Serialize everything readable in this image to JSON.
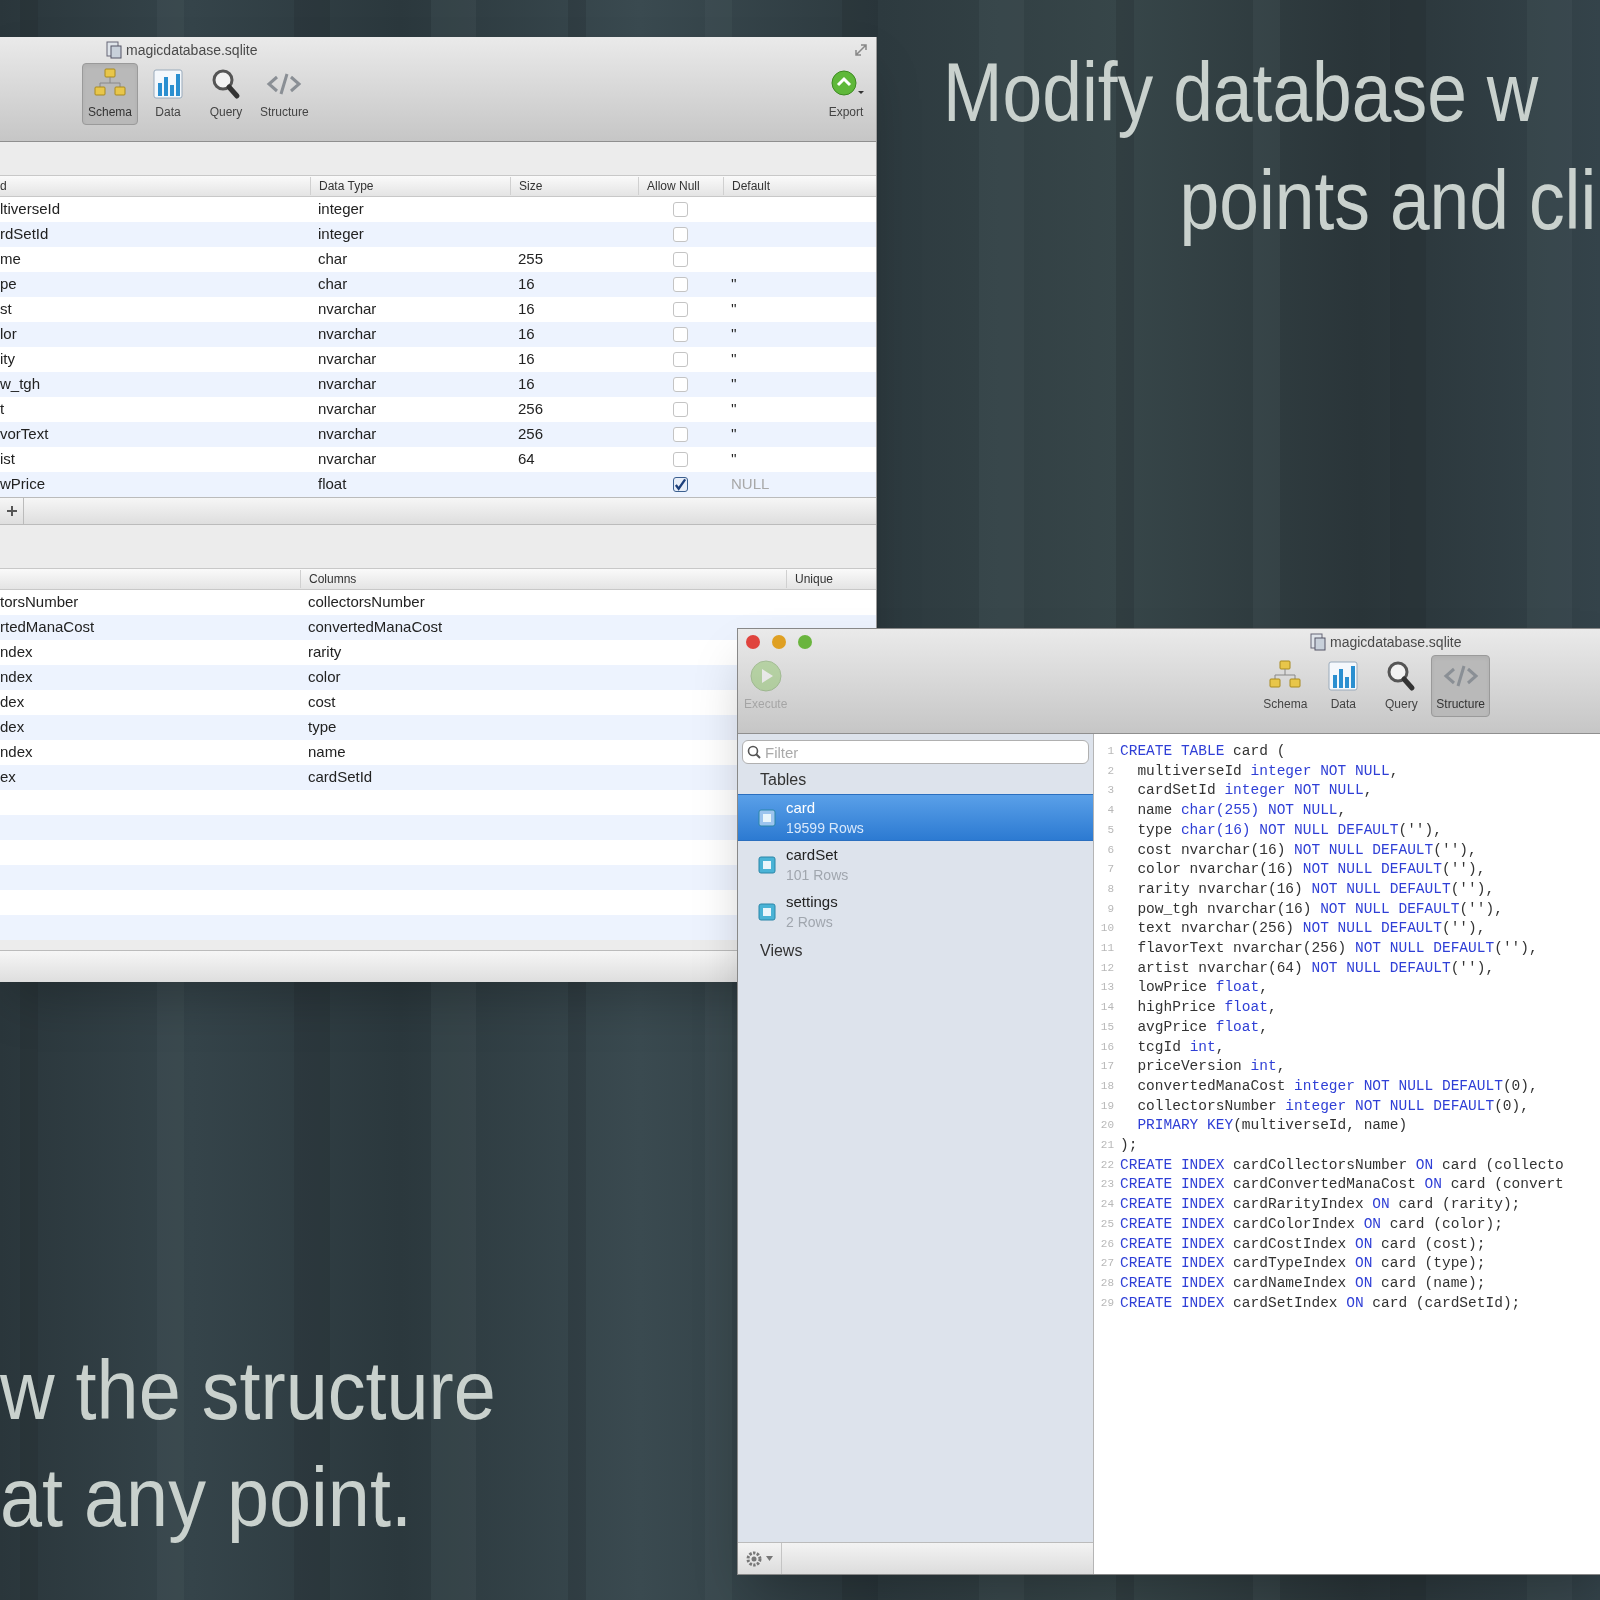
{
  "headline": [
    "Modify database w",
    "points and cli"
  ],
  "caption": [
    "w the structure",
    "at any point."
  ],
  "schema_window": {
    "title": "magicdatabase.sqlite",
    "toolbar": [
      {
        "label": "Schema",
        "kind": "schema",
        "selected": true
      },
      {
        "label": "Data",
        "kind": "data",
        "selected": false
      },
      {
        "label": "Query",
        "kind": "query",
        "selected": false
      },
      {
        "label": "Structure",
        "kind": "structure",
        "selected": false
      }
    ],
    "export": {
      "label": "Export"
    },
    "fields_table": {
      "columns": [
        "d",
        "Data Type",
        "Size",
        "Allow Null",
        "Default"
      ],
      "rows": [
        {
          "name": "ltiverseId",
          "data_type": "integer",
          "allow_null": false
        },
        {
          "name": "rdSetId",
          "data_type": "integer",
          "allow_null": false
        },
        {
          "name": "me",
          "data_type": "char",
          "size": "255",
          "allow_null": false
        },
        {
          "name": "pe",
          "data_type": "char",
          "size": "16",
          "allow_null": false,
          "default": "''",
          "dimmed": false
        },
        {
          "name": "st",
          "data_type": "nvarchar",
          "size": "16",
          "allow_null": false,
          "default": "''",
          "dimmed": false
        },
        {
          "name": "lor",
          "data_type": "nvarchar",
          "size": "16",
          "allow_null": false,
          "default": "''",
          "dimmed": false
        },
        {
          "name": "ity",
          "data_type": "nvarchar",
          "size": "16",
          "allow_null": false,
          "default": "''",
          "dimmed": false
        },
        {
          "name": "w_tgh",
          "data_type": "nvarchar",
          "size": "16",
          "allow_null": false,
          "default": "''",
          "dimmed": false
        },
        {
          "name": "t",
          "data_type": "nvarchar",
          "size": "256",
          "allow_null": false,
          "default": "''",
          "dimmed": false
        },
        {
          "name": "vorText",
          "data_type": "nvarchar",
          "size": "256",
          "allow_null": false,
          "default": "''",
          "dimmed": false
        },
        {
          "name": "ist",
          "data_type": "nvarchar",
          "size": "64",
          "allow_null": false,
          "default": "''",
          "dimmed": false
        },
        {
          "name": "wPrice",
          "data_type": "float",
          "allow_null": true,
          "default": "NULL",
          "dimmed": true
        }
      ]
    },
    "indexes_table": {
      "columns": [
        "Columns",
        "Unique"
      ],
      "rows": [
        {
          "name": "torsNumber",
          "columns": "collectorsNumber"
        },
        {
          "name": "rtedManaCost",
          "columns": "convertedManaCost"
        },
        {
          "name": "ndex",
          "columns": "rarity"
        },
        {
          "name": "ndex",
          "columns": "color"
        },
        {
          "name": "dex",
          "columns": "cost"
        },
        {
          "name": "dex",
          "columns": "type"
        },
        {
          "name": "ndex",
          "columns": "name"
        },
        {
          "name": "ex",
          "columns": "cardSetId"
        }
      ]
    }
  },
  "sql_window": {
    "title": "magicdatabase.sqlite",
    "execute": {
      "label": "Execute",
      "disabled": true
    },
    "toolbar": [
      {
        "label": "Schema",
        "kind": "schema",
        "selected": false
      },
      {
        "label": "Data",
        "kind": "data",
        "selected": false
      },
      {
        "label": "Query",
        "kind": "query",
        "selected": false
      },
      {
        "label": "Structure",
        "kind": "structure",
        "selected": true
      }
    ],
    "filter": {
      "placeholder": "Filter"
    },
    "sidebar": {
      "sections": [
        {
          "label": "Tables",
          "items": [
            {
              "name": "card",
              "rows": "19599 Rows",
              "selected": true
            },
            {
              "name": "cardSet",
              "rows": "101 Rows",
              "selected": false
            },
            {
              "name": "settings",
              "rows": "2 Rows",
              "selected": false
            }
          ]
        },
        {
          "label": "Views"
        }
      ]
    },
    "code": [
      {
        "number": "1",
        "segments": [
          {
            "text": "CREATE TABLE",
            "kind": "keyword"
          },
          {
            "text": " card (",
            "kind": "plain"
          }
        ]
      },
      {
        "number": "2",
        "segments": [
          {
            "text": "  multiverseId ",
            "kind": "plain"
          },
          {
            "text": "integer NOT NULL",
            "kind": "keyword"
          },
          {
            "text": ",",
            "kind": "plain"
          }
        ]
      },
      {
        "number": "3",
        "segments": [
          {
            "text": "  cardSetId ",
            "kind": "plain"
          },
          {
            "text": "integer NOT NULL",
            "kind": "keyword"
          },
          {
            "text": ",",
            "kind": "plain"
          }
        ]
      },
      {
        "number": "4",
        "segments": [
          {
            "text": "  name ",
            "kind": "plain"
          },
          {
            "text": "char(255) NOT NULL",
            "kind": "keyword"
          },
          {
            "text": ",",
            "kind": "plain"
          }
        ]
      },
      {
        "number": "5",
        "segments": [
          {
            "text": "  type ",
            "kind": "plain"
          },
          {
            "text": "char(16) NOT NULL DEFAULT",
            "kind": "keyword"
          },
          {
            "text": "(''),",
            "kind": "plain"
          }
        ]
      },
      {
        "number": "6",
        "segments": [
          {
            "text": "  cost nvarchar(16) ",
            "kind": "plain"
          },
          {
            "text": "NOT NULL DEFAULT",
            "kind": "keyword"
          },
          {
            "text": "(''),",
            "kind": "plain"
          }
        ]
      },
      {
        "number": "7",
        "segments": [
          {
            "text": "  color nvarchar(16) ",
            "kind": "plain"
          },
          {
            "text": "NOT NULL DEFAULT",
            "kind": "keyword"
          },
          {
            "text": "(''),",
            "kind": "plain"
          }
        ]
      },
      {
        "number": "8",
        "segments": [
          {
            "text": "  rarity nvarchar(16) ",
            "kind": "plain"
          },
          {
            "text": "NOT NULL DEFAULT",
            "kind": "keyword"
          },
          {
            "text": "(''),",
            "kind": "plain"
          }
        ]
      },
      {
        "number": "9",
        "segments": [
          {
            "text": "  pow_tgh nvarchar(16) ",
            "kind": "plain"
          },
          {
            "text": "NOT NULL DEFAULT",
            "kind": "keyword"
          },
          {
            "text": "(''),",
            "kind": "plain"
          }
        ]
      },
      {
        "number": "10",
        "segments": [
          {
            "text": "  text nvarchar(256) ",
            "kind": "plain"
          },
          {
            "text": "NOT NULL DEFAULT",
            "kind": "keyword"
          },
          {
            "text": "(''),",
            "kind": "plain"
          }
        ]
      },
      {
        "number": "11",
        "segments": [
          {
            "text": "  flavorText nvarchar(256) ",
            "kind": "plain"
          },
          {
            "text": "NOT NULL DEFAULT",
            "kind": "keyword"
          },
          {
            "text": "(''),",
            "kind": "plain"
          }
        ]
      },
      {
        "number": "12",
        "segments": [
          {
            "text": "  artist nvarchar(64) ",
            "kind": "plain"
          },
          {
            "text": "NOT NULL DEFAULT",
            "kind": "keyword"
          },
          {
            "text": "(''),",
            "kind": "plain"
          }
        ]
      },
      {
        "number": "13",
        "segments": [
          {
            "text": "  lowPrice ",
            "kind": "plain"
          },
          {
            "text": "float",
            "kind": "keyword"
          },
          {
            "text": ",",
            "kind": "plain"
          }
        ]
      },
      {
        "number": "14",
        "segments": [
          {
            "text": "  highPrice ",
            "kind": "plain"
          },
          {
            "text": "float",
            "kind": "keyword"
          },
          {
            "text": ",",
            "kind": "plain"
          }
        ]
      },
      {
        "number": "15",
        "segments": [
          {
            "text": "  avgPrice ",
            "kind": "plain"
          },
          {
            "text": "float",
            "kind": "keyword"
          },
          {
            "text": ",",
            "kind": "plain"
          }
        ]
      },
      {
        "number": "16",
        "segments": [
          {
            "text": "  tcgId ",
            "kind": "plain"
          },
          {
            "text": "int",
            "kind": "keyword"
          },
          {
            "text": ",",
            "kind": "plain"
          }
        ]
      },
      {
        "number": "17",
        "segments": [
          {
            "text": "  priceVersion ",
            "kind": "plain"
          },
          {
            "text": "int",
            "kind": "keyword"
          },
          {
            "text": ",",
            "kind": "plain"
          }
        ]
      },
      {
        "number": "18",
        "segments": [
          {
            "text": "  convertedManaCost ",
            "kind": "plain"
          },
          {
            "text": "integer NOT NULL DEFAULT",
            "kind": "keyword"
          },
          {
            "text": "(0),",
            "kind": "plain"
          }
        ]
      },
      {
        "number": "19",
        "segments": [
          {
            "text": "  collectorsNumber ",
            "kind": "plain"
          },
          {
            "text": "integer NOT NULL DEFAULT",
            "kind": "keyword"
          },
          {
            "text": "(0),",
            "kind": "plain"
          }
        ]
      },
      {
        "number": "20",
        "segments": [
          {
            "text": "  PRIMARY KEY",
            "kind": "keyword"
          },
          {
            "text": "(multiverseId, name)",
            "kind": "plain"
          }
        ]
      },
      {
        "number": "21",
        "segments": [
          {
            "text": ");",
            "kind": "plain"
          }
        ]
      },
      {
        "number": "22",
        "segments": [
          {
            "text": "CREATE INDEX",
            "kind": "keyword"
          },
          {
            "text": " cardCollectorsNumber ",
            "kind": "plain"
          },
          {
            "text": "ON",
            "kind": "keyword"
          },
          {
            "text": " card (collecto",
            "kind": "plain"
          }
        ]
      },
      {
        "number": "23",
        "segments": [
          {
            "text": "CREATE INDEX",
            "kind": "keyword"
          },
          {
            "text": " cardConvertedManaCost ",
            "kind": "plain"
          },
          {
            "text": "ON",
            "kind": "keyword"
          },
          {
            "text": " card (convert",
            "kind": "plain"
          }
        ]
      },
      {
        "number": "24",
        "segments": [
          {
            "text": "CREATE INDEX",
            "kind": "keyword"
          },
          {
            "text": " cardRarityIndex ",
            "kind": "plain"
          },
          {
            "text": "ON",
            "kind": "keyword"
          },
          {
            "text": " card (rarity);",
            "kind": "plain"
          }
        ]
      },
      {
        "number": "25",
        "segments": [
          {
            "text": "CREATE INDEX",
            "kind": "keyword"
          },
          {
            "text": " cardColorIndex ",
            "kind": "plain"
          },
          {
            "text": "ON",
            "kind": "keyword"
          },
          {
            "text": " card (color);",
            "kind": "plain"
          }
        ]
      },
      {
        "number": "26",
        "segments": [
          {
            "text": "CREATE INDEX",
            "kind": "keyword"
          },
          {
            "text": " cardCostIndex ",
            "kind": "plain"
          },
          {
            "text": "ON",
            "kind": "keyword"
          },
          {
            "text": " card (cost);",
            "kind": "plain"
          }
        ]
      },
      {
        "number": "27",
        "segments": [
          {
            "text": "CREATE INDEX",
            "kind": "keyword"
          },
          {
            "text": " cardTypeIndex ",
            "kind": "plain"
          },
          {
            "text": "ON",
            "kind": "keyword"
          },
          {
            "text": " card (type);",
            "kind": "plain"
          }
        ]
      },
      {
        "number": "28",
        "segments": [
          {
            "text": "CREATE INDEX",
            "kind": "keyword"
          },
          {
            "text": " cardNameIndex ",
            "kind": "plain"
          },
          {
            "text": "ON",
            "kind": "keyword"
          },
          {
            "text": " card (name);",
            "kind": "plain"
          }
        ]
      },
      {
        "number": "29",
        "segments": [
          {
            "text": "CREATE INDEX",
            "kind": "keyword"
          },
          {
            "text": " cardSetIndex ",
            "kind": "plain"
          },
          {
            "text": "ON",
            "kind": "keyword"
          },
          {
            "text": " card (cardSetId);",
            "kind": "plain"
          }
        ]
      }
    ]
  }
}
